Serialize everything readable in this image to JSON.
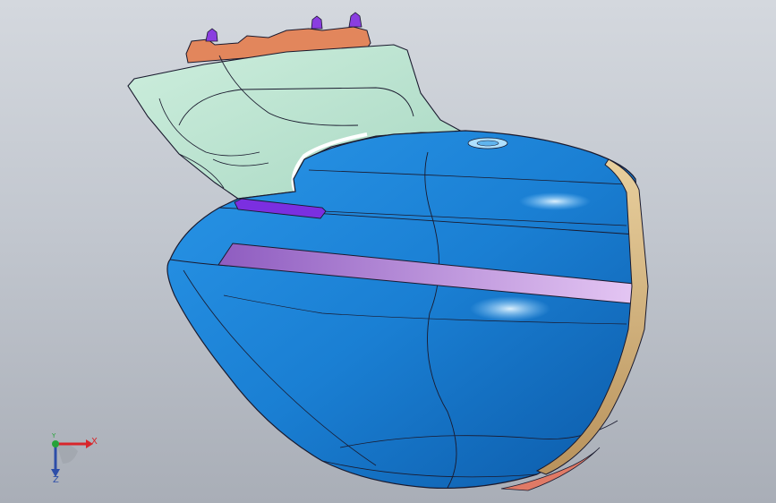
{
  "viewport": {
    "background_top": "#d4d8de",
    "background_bottom": "#a9aeb7"
  },
  "model": {
    "colors": {
      "body_blue": "#1a7fd3",
      "body_blue_dark": "#0c5aa8",
      "highlight": "#aee0ff",
      "top_cover_mint": "#bfe6d4",
      "top_cover_shade": "#9ccfb9",
      "connector_orange": "#e2865c",
      "pin_purple": "#8a3ee0",
      "slot_lilac": "#b07ad8",
      "rim_gold": "#d6b88a",
      "edge_line": "#1a1a2e"
    }
  },
  "triad": {
    "x_label": "X",
    "y_label": "Y",
    "z_label": "Z",
    "colors": {
      "x": "#d8262b",
      "y": "#27a33a",
      "z": "#2d4ea8"
    }
  }
}
